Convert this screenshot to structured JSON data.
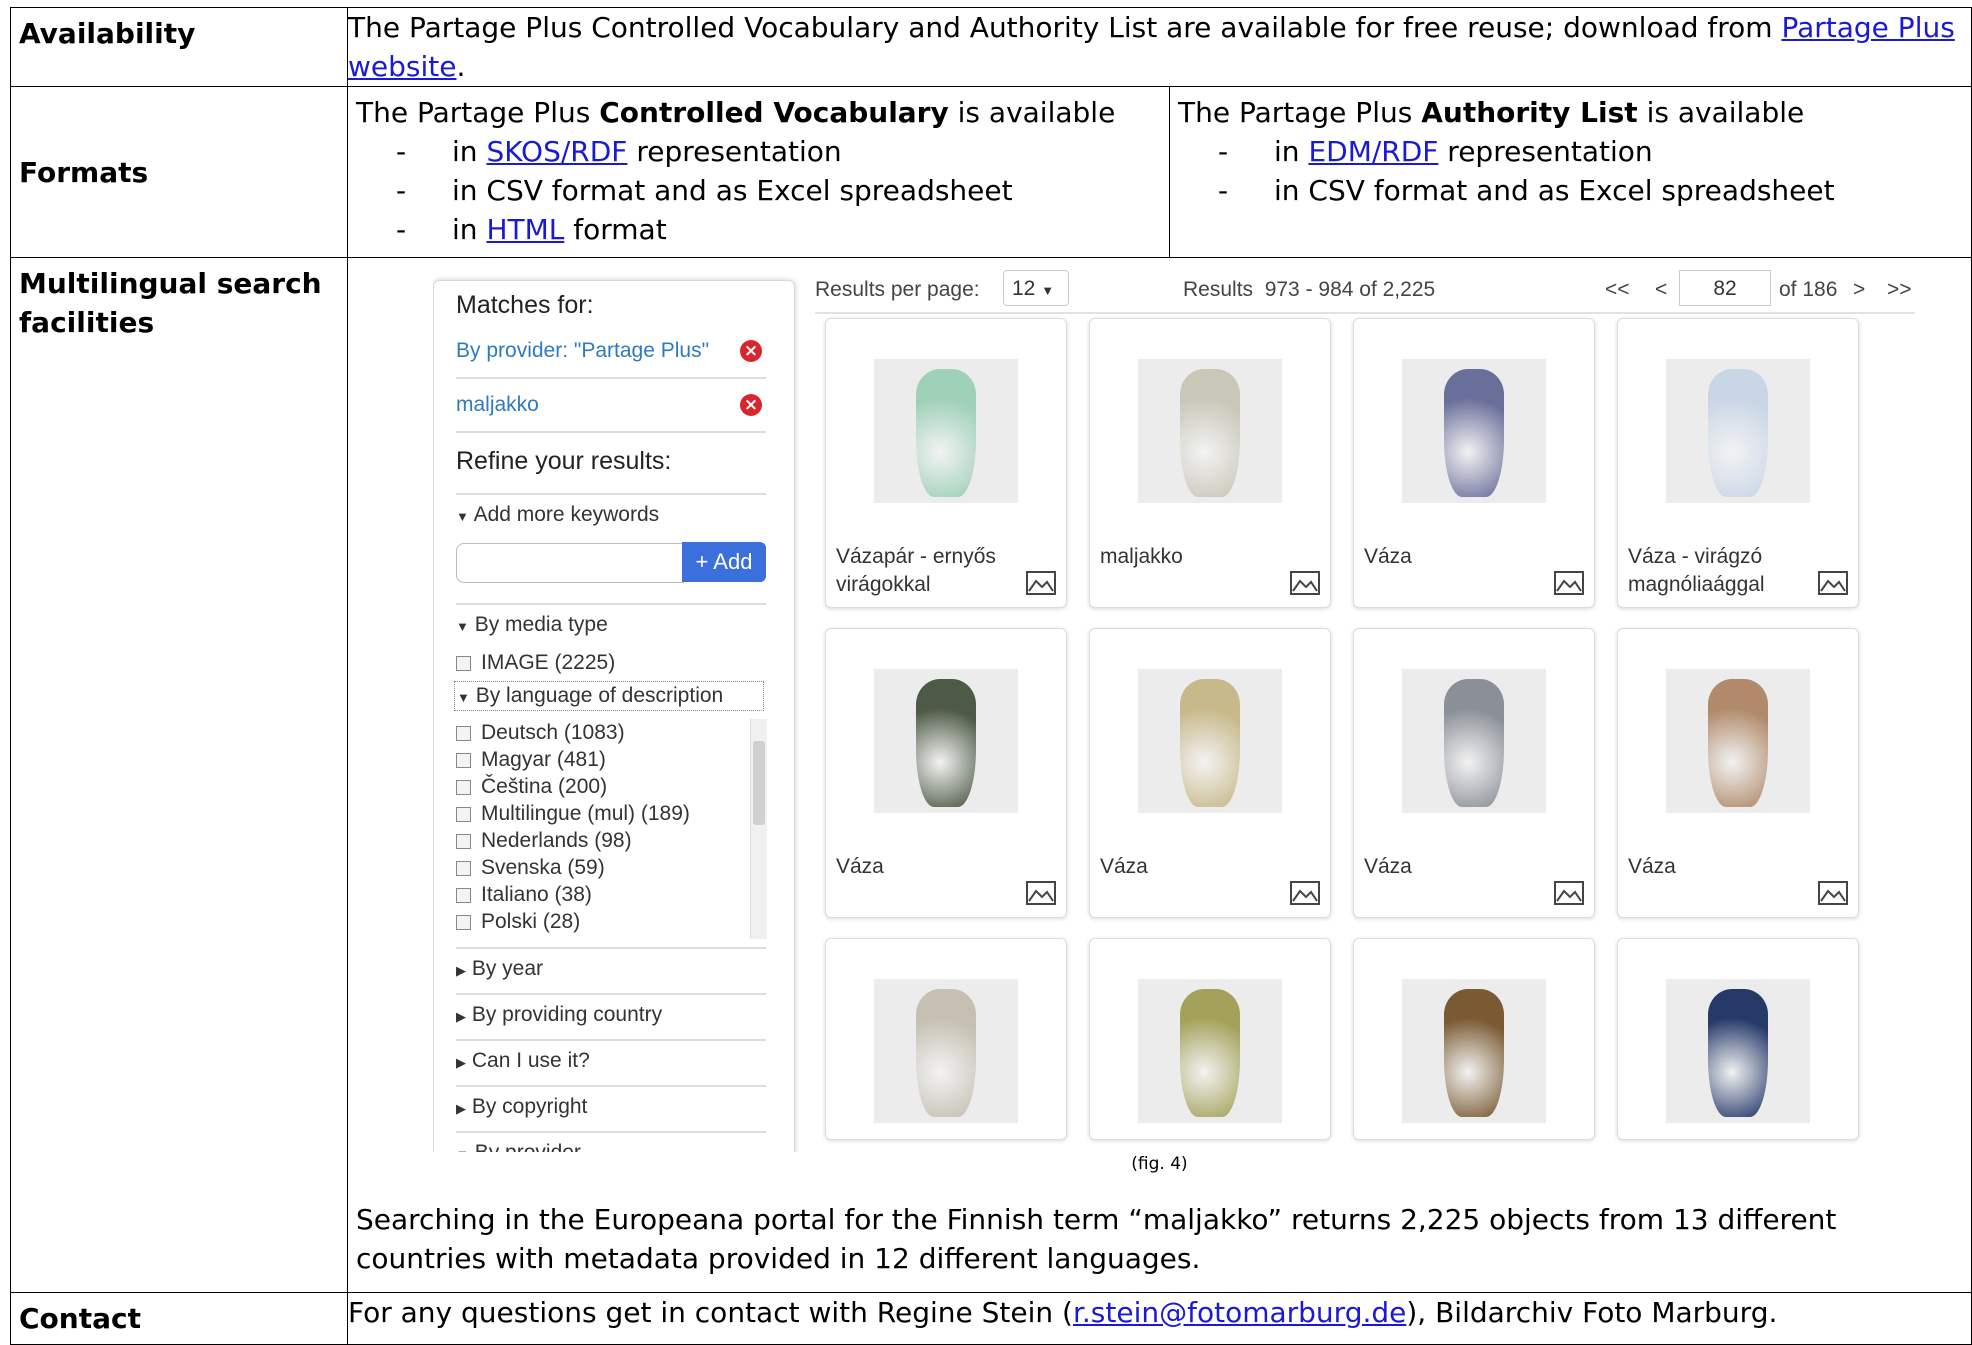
{
  "rows": {
    "availability": {
      "label": "Availability",
      "text_before": "The Partage Plus Controlled Vocabulary and Authority List are available for free reuse; download from ",
      "link": "Partage Plus website",
      "text_after": "."
    },
    "formats": {
      "label": "Formats",
      "left": {
        "intro_before": "The Partage Plus ",
        "intro_bold": "Controlled Vocabulary",
        "intro_after": " is available",
        "items": [
          {
            "before": "in ",
            "link": "SKOS/RDF",
            "after": " representation"
          },
          {
            "before": "in CSV format and as Excel spreadsheet",
            "link": "",
            "after": ""
          },
          {
            "before": "in ",
            "link": "HTML",
            "after": " format"
          }
        ]
      },
      "right": {
        "intro_before": "The Partage Plus ",
        "intro_bold": "Authority List",
        "intro_after": " is available",
        "items": [
          {
            "before": "in ",
            "link": "EDM/RDF",
            "after": " representation"
          },
          {
            "before": "in CSV format and as Excel spreadsheet",
            "link": "",
            "after": ""
          }
        ]
      }
    },
    "multilingual": {
      "label": "Multilingual search facilities",
      "fig_caption": "(fig. 4)",
      "description": "Searching in the Europeana portal for the Finnish term “maljakko” returns 2,225 objects from 13 different countries with metadata provided in 12 different languages."
    },
    "contact": {
      "label": "Contact",
      "text_before": "For any questions get in contact with Regine Stein (",
      "link": "r.stein@fotomarburg.de",
      "text_after": "), Bildarchiv Foto Marburg."
    }
  },
  "screenshot": {
    "sidebar": {
      "matches_for": "Matches for:",
      "filter_provider": "By provider: \"Partage Plus\"",
      "filter_term": "maljakko",
      "refine": "Refine your results:",
      "add_more_keywords": "Add more keywords",
      "add_button": "+ Add",
      "by_media_type": "By media type",
      "image_option": "IMAGE (2225)",
      "by_language": "By language of description",
      "languages": [
        "Deutsch (1083)",
        "Magyar (481)",
        "Čeština (200)",
        "Multilingue (mul) (189)",
        "Nederlands (98)",
        "Svenska (59)",
        "Italiano (38)",
        "Polski (28)"
      ],
      "collapsed_sections": [
        "By year",
        "By providing country",
        "Can I use it?",
        "By copyright"
      ],
      "cut_section": "By provider"
    },
    "toolbar": {
      "results_per_page_label": "Results per page:",
      "results_per_page_value": "12",
      "results_label": "Results",
      "results_range": "973 - 984 of 2,225",
      "first": "<<",
      "prev": "<",
      "page": "82",
      "of_pages": "of 186",
      "next": ">",
      "last": ">>"
    },
    "results": [
      {
        "title": "Vázapár - ernyős virágokkal",
        "color": "#9fd0b8"
      },
      {
        "title": "maljakko",
        "color": "#c9c7b8"
      },
      {
        "title": "Váza",
        "color": "#6a6f9a"
      },
      {
        "title": "Váza - virágzó magnóliaággal",
        "color": "#c9d6e6"
      },
      {
        "title": "Váza",
        "color": "#4d5a45"
      },
      {
        "title": "Váza",
        "color": "#c7b98a"
      },
      {
        "title": "Váza",
        "color": "#8a8f98"
      },
      {
        "title": "Váza",
        "color": "#b08a6a"
      },
      {
        "title": "",
        "color": "#c5c0b2"
      },
      {
        "title": "",
        "color": "#a4a25a"
      },
      {
        "title": "",
        "color": "#7a5a32"
      },
      {
        "title": "",
        "color": "#263a6a"
      }
    ]
  }
}
